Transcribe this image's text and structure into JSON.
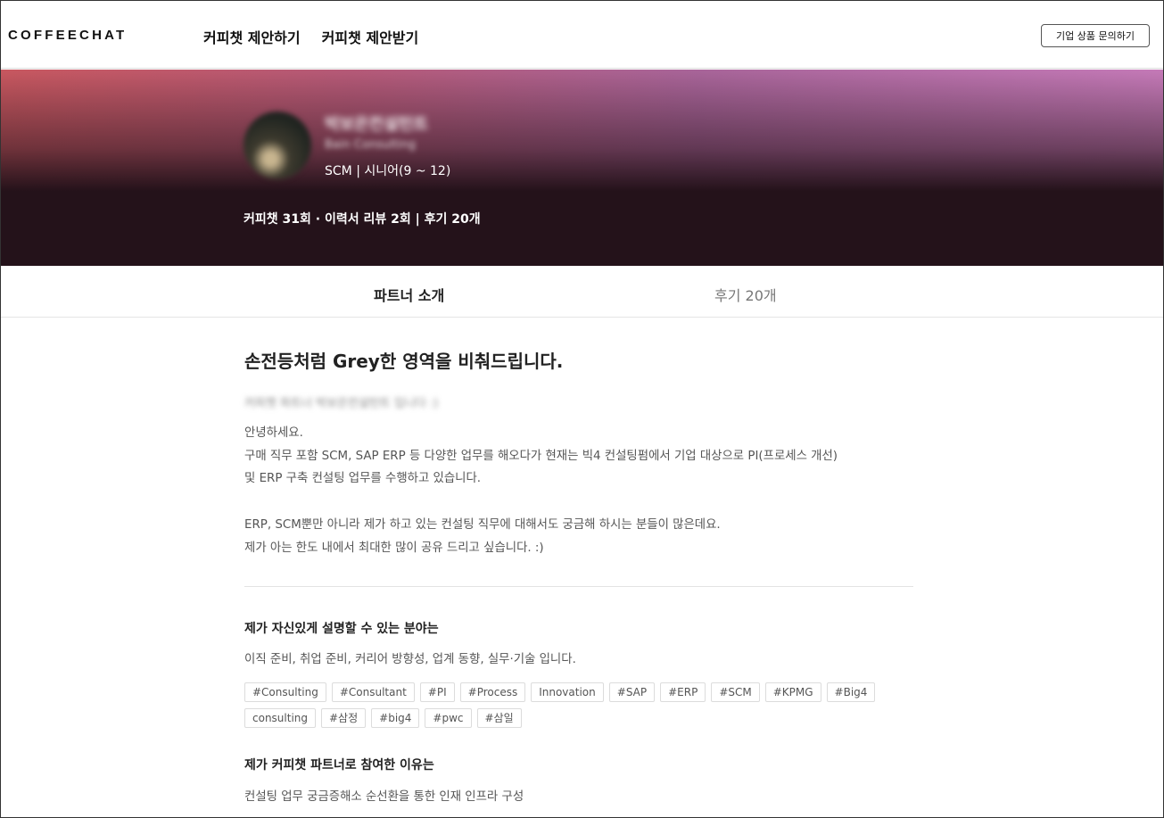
{
  "header": {
    "logo": "COFFEECHAT",
    "nav": [
      "커피챗 제안하기",
      "커피챗 제안받기"
    ],
    "inquiry_button": "기업 상품 문의하기"
  },
  "hero": {
    "name": "박보은컨설턴트",
    "company": "Bain Consulting",
    "role": "SCM | 시니어(9 ~ 12)",
    "stats": "커피챗 31회 · 이력서 리뷰 2회 | 후기 20개"
  },
  "tabs": {
    "intro": "파트너 소개",
    "reviews": "후기 20개"
  },
  "content": {
    "headline": "손전등처럼 Grey한 영역을 비춰드립니다.",
    "blurred_line": "커피챗 파트너 박보은컨설턴트 입니다 :)",
    "intro_lines": [
      "안녕하세요.",
      "구매 직무 포함 SCM, SAP ERP 등 다양한 업무를 해오다가 현재는 빅4 컨설팅펌에서 기업 대상으로 PI(프로세스 개선)",
      "및 ERP 구축 컨설팅 업무를 수행하고 있습니다.",
      "",
      "ERP, SCM뿐만 아니라 제가 하고 있는 컨설팅 직무에 대해서도 궁금해 하시는 분들이 많은데요.",
      "제가 아는 한도 내에서 최대한 많이 공유 드리고 싶습니다. :)"
    ],
    "expertise_title": "제가 자신있게 설명할 수 있는 분야는",
    "expertise_text": "이직 준비, 취업 준비, 커리어 방향성, 업계 동향, 실무·기술 입니다.",
    "tags": [
      "#Consulting",
      "#Consultant",
      "#PI",
      "#Process",
      "Innovation",
      "#SAP",
      "#ERP",
      "#SCM",
      "#KPMG",
      "#Big4",
      "consulting",
      "#삼정",
      "#big4",
      "#pwc",
      "#삼일"
    ],
    "reason_title": "제가 커피챗 파트너로 참여한 이유는",
    "reason_text": "컨설팅 업무 궁금증해소 순선환을 통한 인재 인프라 구성"
  }
}
